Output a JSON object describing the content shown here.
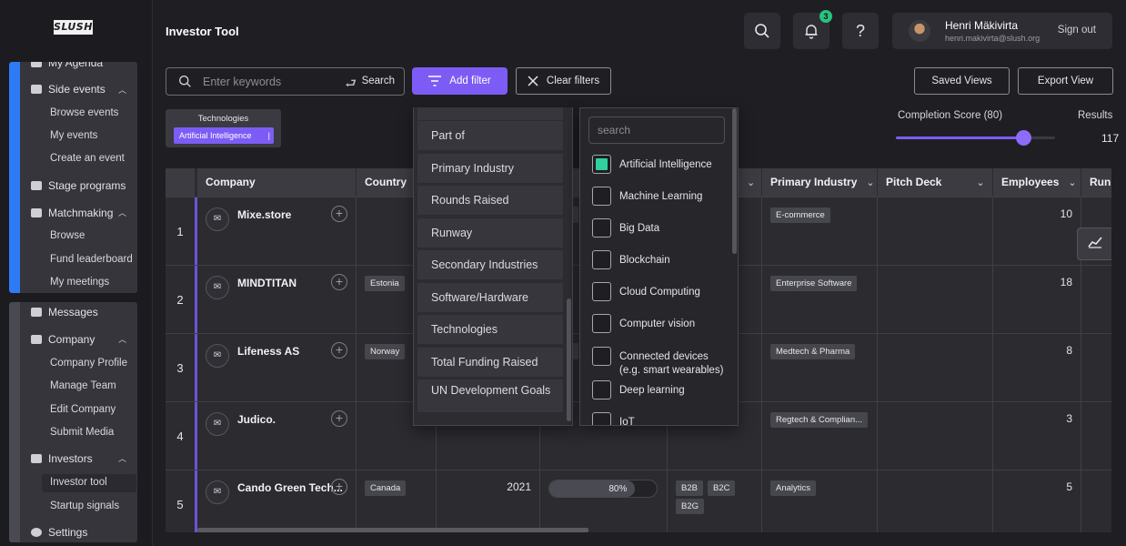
{
  "app": {
    "logo": "SLUSH",
    "title": "Investor Tool"
  },
  "header": {
    "notifications_count": "3",
    "help_label": "?",
    "user": {
      "name": "Henri Mäkivirta",
      "email": "henri.makivirta@slush.org",
      "signout": "Sign out"
    }
  },
  "sidebar": {
    "group1": [
      {
        "label": "My Agenda",
        "type": "head",
        "icon": "pin-icon"
      },
      {
        "label": "Side events",
        "type": "head",
        "icon": "calendar-icon",
        "expanded": true
      },
      {
        "label": "Browse events",
        "type": "sub"
      },
      {
        "label": "My events",
        "type": "sub"
      },
      {
        "label": "Create an event",
        "type": "sub"
      },
      {
        "label": "Stage programs",
        "type": "head",
        "icon": "stage-icon"
      },
      {
        "label": "Matchmaking",
        "type": "head",
        "icon": "people-icon",
        "expanded": true
      },
      {
        "label": "Browse",
        "type": "sub"
      },
      {
        "label": "Fund leaderboard",
        "type": "sub"
      },
      {
        "label": "My meetings",
        "type": "sub"
      }
    ],
    "group2": [
      {
        "label": "Messages",
        "type": "head",
        "icon": "message-icon"
      },
      {
        "label": "Company",
        "type": "head",
        "icon": "briefcase-icon",
        "expanded": true
      },
      {
        "label": "Company Profile",
        "type": "sub"
      },
      {
        "label": "Manage Team",
        "type": "sub"
      },
      {
        "label": "Edit Company",
        "type": "sub"
      },
      {
        "label": "Submit Media",
        "type": "sub"
      },
      {
        "label": "Investors",
        "type": "head",
        "icon": "list-icon",
        "expanded": true
      },
      {
        "label": "Investor tool",
        "type": "sub",
        "active": true
      },
      {
        "label": "Startup signals",
        "type": "sub"
      },
      {
        "label": "Settings",
        "type": "head",
        "icon": "gear-icon"
      }
    ]
  },
  "toolbar": {
    "search_placeholder": "Enter keywords",
    "search_button": "Search",
    "add_filter": "Add filter",
    "clear_filters": "Clear filters",
    "saved_views": "Saved Views",
    "export_view": "Export View"
  },
  "active_filter": {
    "label": "Technologies",
    "value": "Artificial Intelligence",
    "suffix": "|"
  },
  "completion": {
    "label": "Completion Score (80)",
    "value": 80
  },
  "results": {
    "label": "Results",
    "value": "117"
  },
  "table": {
    "columns": [
      "Company",
      "Country",
      "",
      "",
      "",
      "Primary Industry",
      "Pitch Deck",
      "Employees",
      "Run"
    ],
    "rows": [
      {
        "num": "1",
        "company": "Mixe.store",
        "country": "",
        "year": "",
        "progress": null,
        "models": [],
        "industry": "E-commerce",
        "employees": "10"
      },
      {
        "num": "2",
        "company": "MINDTITAN",
        "country": "Estonia",
        "year": "",
        "progress": null,
        "models": [],
        "industry": "Enterprise Software",
        "employees": "18"
      },
      {
        "num": "3",
        "company": "Lifeness AS",
        "country": "Norway",
        "year": "",
        "progress": null,
        "models": [],
        "industry": "Medtech & Pharma",
        "employees": "8"
      },
      {
        "num": "4",
        "company": "Judico.",
        "country": "",
        "year": "",
        "progress": null,
        "models": [],
        "industry": "Regtech & Complian...",
        "employees": "3"
      },
      {
        "num": "5",
        "company": "Cando Green Tech...",
        "country": "Canada",
        "year": "2021",
        "progress": "80%",
        "progress_value": 80,
        "models": [
          "B2B",
          "B2C",
          "B2G"
        ],
        "industry": "Analytics",
        "employees": "5"
      }
    ]
  },
  "filter_menu": {
    "items": [
      "Part of",
      "Primary Industry",
      "Rounds Raised",
      "Runway",
      "Secondary Industries",
      "Software/Hardware",
      "Technologies",
      "Total Funding Raised",
      "UN Development Goals"
    ]
  },
  "tech_menu": {
    "search_placeholder": "search",
    "options": [
      {
        "label": "Artificial Intelligence",
        "checked": true
      },
      {
        "label": "Machine Learning",
        "checked": false
      },
      {
        "label": "Big Data",
        "checked": false
      },
      {
        "label": "Blockchain",
        "checked": false
      },
      {
        "label": "Cloud Computing",
        "checked": false
      },
      {
        "label": "Computer vision",
        "checked": false
      },
      {
        "label": "Connected devices\n(e.g. smart wearables)",
        "checked": false
      },
      {
        "label": "Deep learning",
        "checked": false
      },
      {
        "label": "IoT",
        "checked": false
      }
    ]
  },
  "colors": {
    "accent": "#7c5cf5",
    "sidebar_accent": "#2f7bf5",
    "check_on": "#2fd09c",
    "notif": "#27c281"
  }
}
